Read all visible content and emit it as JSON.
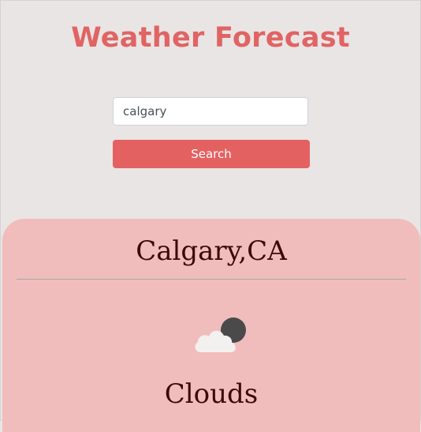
{
  "header": {
    "title": "Weather Forecast"
  },
  "search": {
    "value": "calgary",
    "button_label": "Search"
  },
  "result": {
    "city": "Calgary,CA",
    "condition": "Clouds",
    "icon": "cloudy-night-icon"
  },
  "colors": {
    "accent": "#e06464",
    "button": "#e46162",
    "card_background": "#f0bdbc",
    "page_background": "#e9e5e4",
    "text_dark": "#3a0909"
  }
}
